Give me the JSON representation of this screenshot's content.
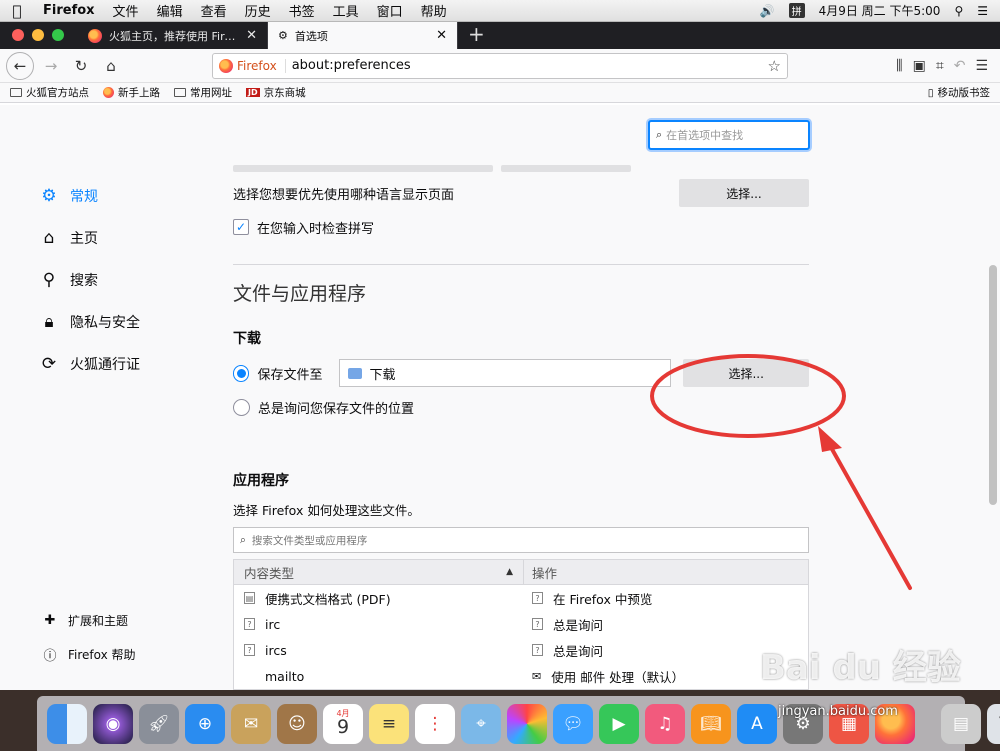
{
  "menubar": {
    "app": "Firefox",
    "items": [
      "文件",
      "编辑",
      "查看",
      "历史",
      "书签",
      "工具",
      "窗口",
      "帮助"
    ],
    "ime": "拼",
    "clock": "4月9日 周二 下午5:00"
  },
  "tabs": [
    {
      "title": "火狐主页，推荐使用 Firefox 火狐"
    },
    {
      "title": "首选项"
    }
  ],
  "navbar": {
    "brand": "Firefox",
    "url": "about:preferences"
  },
  "bookmarks": {
    "items": [
      "火狐官方站点",
      "新手上路",
      "常用网址",
      "京东商城"
    ],
    "mobile": "移动版书签"
  },
  "search": {
    "placeholder": "在首选项中查找"
  },
  "sidebar": {
    "items": [
      {
        "label": "常规",
        "icon": "gear-icon"
      },
      {
        "label": "主页",
        "icon": "home-icon"
      },
      {
        "label": "搜索",
        "icon": "search-icon"
      },
      {
        "label": "隐私与安全",
        "icon": "lock-icon"
      },
      {
        "label": "火狐通行证",
        "icon": "sync-icon"
      }
    ],
    "bottom": [
      {
        "label": "扩展和主题",
        "icon": "puzzle-icon"
      },
      {
        "label": "Firefox 帮助",
        "icon": "help-icon"
      }
    ]
  },
  "general": {
    "language_text": "选择您想要优先使用哪种语言显示页面",
    "choose_label": "选择...",
    "spellcheck_label": "在您输入时检查拼写",
    "spellcheck_checked": true
  },
  "files": {
    "section_title": "文件与应用程序",
    "downloads_head": "下载",
    "save_to_label": "保存文件至",
    "folder": "下载",
    "choose_label": "选择...",
    "always_ask_label": "总是询问您保存文件的位置",
    "applications_head": "应用程序",
    "applications_desc": "选择 Firefox 如何处理这些文件。",
    "app_search_placeholder": "搜索文件类型或应用程序",
    "col_content_type": "内容类型",
    "col_action": "操作",
    "rows": [
      {
        "type": "便携式文档格式 (PDF)",
        "action": "在 Firefox 中预览"
      },
      {
        "type": "irc",
        "action": "总是询问"
      },
      {
        "type": "ircs",
        "action": "总是询问"
      },
      {
        "type": "mailto",
        "action": "使用 邮件 处理（默认）"
      }
    ]
  },
  "watermark": {
    "text": "Bai du 经验",
    "url": "jingyan.baidu.com"
  },
  "dock": {
    "calendar_month": "4月",
    "calendar_day": "9"
  },
  "colors": {
    "accent": "#0a84ff",
    "annotation": "#e53935"
  }
}
